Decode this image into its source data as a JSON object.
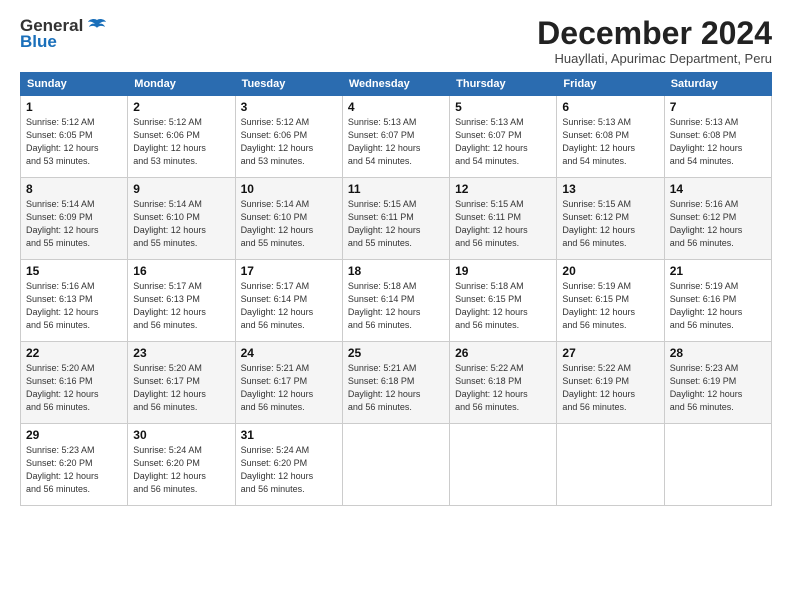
{
  "header": {
    "logo_line1": "General",
    "logo_line2": "Blue",
    "title": "December 2024",
    "subtitle": "Huayllati, Apurimac Department, Peru"
  },
  "calendar": {
    "weekdays": [
      "Sunday",
      "Monday",
      "Tuesday",
      "Wednesday",
      "Thursday",
      "Friday",
      "Saturday"
    ],
    "weeks": [
      [
        {
          "day": "",
          "info": ""
        },
        {
          "day": "2",
          "info": "Sunrise: 5:12 AM\nSunset: 6:06 PM\nDaylight: 12 hours\nand 53 minutes."
        },
        {
          "day": "3",
          "info": "Sunrise: 5:12 AM\nSunset: 6:06 PM\nDaylight: 12 hours\nand 53 minutes."
        },
        {
          "day": "4",
          "info": "Sunrise: 5:13 AM\nSunset: 6:07 PM\nDaylight: 12 hours\nand 54 minutes."
        },
        {
          "day": "5",
          "info": "Sunrise: 5:13 AM\nSunset: 6:07 PM\nDaylight: 12 hours\nand 54 minutes."
        },
        {
          "day": "6",
          "info": "Sunrise: 5:13 AM\nSunset: 6:08 PM\nDaylight: 12 hours\nand 54 minutes."
        },
        {
          "day": "7",
          "info": "Sunrise: 5:13 AM\nSunset: 6:08 PM\nDaylight: 12 hours\nand 54 minutes."
        }
      ],
      [
        {
          "day": "1",
          "info": "Sunrise: 5:12 AM\nSunset: 6:05 PM\nDaylight: 12 hours\nand 53 minutes."
        },
        {
          "day": "",
          "info": ""
        },
        {
          "day": "",
          "info": ""
        },
        {
          "day": "",
          "info": ""
        },
        {
          "day": "",
          "info": ""
        },
        {
          "day": "",
          "info": ""
        },
        {
          "day": "",
          "info": ""
        }
      ],
      [
        {
          "day": "8",
          "info": "Sunrise: 5:14 AM\nSunset: 6:09 PM\nDaylight: 12 hours\nand 55 minutes."
        },
        {
          "day": "9",
          "info": "Sunrise: 5:14 AM\nSunset: 6:10 PM\nDaylight: 12 hours\nand 55 minutes."
        },
        {
          "day": "10",
          "info": "Sunrise: 5:14 AM\nSunset: 6:10 PM\nDaylight: 12 hours\nand 55 minutes."
        },
        {
          "day": "11",
          "info": "Sunrise: 5:15 AM\nSunset: 6:11 PM\nDaylight: 12 hours\nand 55 minutes."
        },
        {
          "day": "12",
          "info": "Sunrise: 5:15 AM\nSunset: 6:11 PM\nDaylight: 12 hours\nand 56 minutes."
        },
        {
          "day": "13",
          "info": "Sunrise: 5:15 AM\nSunset: 6:12 PM\nDaylight: 12 hours\nand 56 minutes."
        },
        {
          "day": "14",
          "info": "Sunrise: 5:16 AM\nSunset: 6:12 PM\nDaylight: 12 hours\nand 56 minutes."
        }
      ],
      [
        {
          "day": "15",
          "info": "Sunrise: 5:16 AM\nSunset: 6:13 PM\nDaylight: 12 hours\nand 56 minutes."
        },
        {
          "day": "16",
          "info": "Sunrise: 5:17 AM\nSunset: 6:13 PM\nDaylight: 12 hours\nand 56 minutes."
        },
        {
          "day": "17",
          "info": "Sunrise: 5:17 AM\nSunset: 6:14 PM\nDaylight: 12 hours\nand 56 minutes."
        },
        {
          "day": "18",
          "info": "Sunrise: 5:18 AM\nSunset: 6:14 PM\nDaylight: 12 hours\nand 56 minutes."
        },
        {
          "day": "19",
          "info": "Sunrise: 5:18 AM\nSunset: 6:15 PM\nDaylight: 12 hours\nand 56 minutes."
        },
        {
          "day": "20",
          "info": "Sunrise: 5:19 AM\nSunset: 6:15 PM\nDaylight: 12 hours\nand 56 minutes."
        },
        {
          "day": "21",
          "info": "Sunrise: 5:19 AM\nSunset: 6:16 PM\nDaylight: 12 hours\nand 56 minutes."
        }
      ],
      [
        {
          "day": "22",
          "info": "Sunrise: 5:20 AM\nSunset: 6:16 PM\nDaylight: 12 hours\nand 56 minutes."
        },
        {
          "day": "23",
          "info": "Sunrise: 5:20 AM\nSunset: 6:17 PM\nDaylight: 12 hours\nand 56 minutes."
        },
        {
          "day": "24",
          "info": "Sunrise: 5:21 AM\nSunset: 6:17 PM\nDaylight: 12 hours\nand 56 minutes."
        },
        {
          "day": "25",
          "info": "Sunrise: 5:21 AM\nSunset: 6:18 PM\nDaylight: 12 hours\nand 56 minutes."
        },
        {
          "day": "26",
          "info": "Sunrise: 5:22 AM\nSunset: 6:18 PM\nDaylight: 12 hours\nand 56 minutes."
        },
        {
          "day": "27",
          "info": "Sunrise: 5:22 AM\nSunset: 6:19 PM\nDaylight: 12 hours\nand 56 minutes."
        },
        {
          "day": "28",
          "info": "Sunrise: 5:23 AM\nSunset: 6:19 PM\nDaylight: 12 hours\nand 56 minutes."
        }
      ],
      [
        {
          "day": "29",
          "info": "Sunrise: 5:23 AM\nSunset: 6:20 PM\nDaylight: 12 hours\nand 56 minutes."
        },
        {
          "day": "30",
          "info": "Sunrise: 5:24 AM\nSunset: 6:20 PM\nDaylight: 12 hours\nand 56 minutes."
        },
        {
          "day": "31",
          "info": "Sunrise: 5:24 AM\nSunset: 6:20 PM\nDaylight: 12 hours\nand 56 minutes."
        },
        {
          "day": "",
          "info": ""
        },
        {
          "day": "",
          "info": ""
        },
        {
          "day": "",
          "info": ""
        },
        {
          "day": "",
          "info": ""
        }
      ]
    ]
  }
}
